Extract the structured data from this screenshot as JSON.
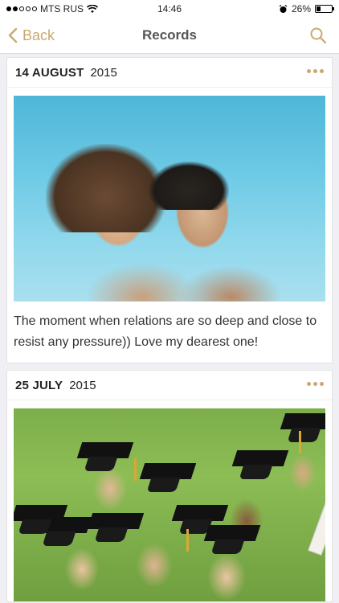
{
  "status_bar": {
    "carrier": "MTS RUS",
    "time": "14:46",
    "battery": "26%",
    "battery_level": 0.26
  },
  "nav": {
    "back_label": "Back",
    "title": "Records",
    "accent_color": "#c9a96e"
  },
  "records": [
    {
      "date_day": "14 AUGUST",
      "date_year": "2015",
      "caption": "The moment when relations are so deep and close to resist any pressure)) Love my dearest one!"
    },
    {
      "date_day": "25 JULY",
      "date_year": "2015"
    }
  ]
}
